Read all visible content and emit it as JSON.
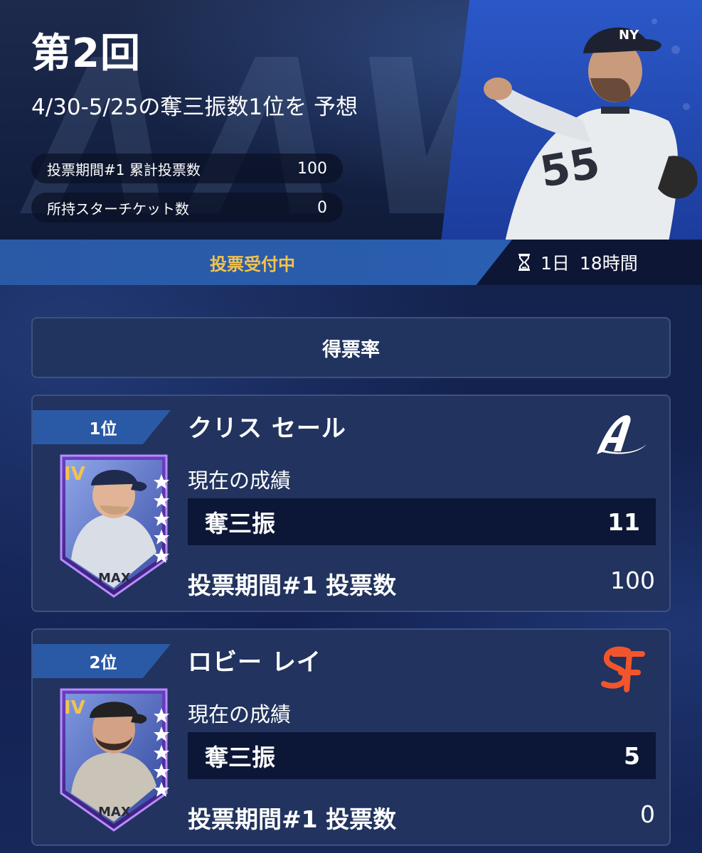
{
  "hero": {
    "round_title": "第2回",
    "subtitle": "4/30-5/25の奪三振数1位を 予想",
    "stats": [
      {
        "label": "投票期間#1 累計投票数",
        "value": "100"
      },
      {
        "label": "所持スターチケット数",
        "value": "0"
      }
    ]
  },
  "status": {
    "label": "投票受付中",
    "countdown_days": "1日",
    "countdown_hours": "18時間",
    "icon": "hourglass-icon"
  },
  "vote_rate_button": {
    "label": "得票率"
  },
  "players": [
    {
      "rank": "1位",
      "name": "クリス セール",
      "team_icon": "braves-logo-icon",
      "card_grade": "IV",
      "card_level": "MAX",
      "current_stats_label": "現在の成績",
      "stat_label": "奪三振",
      "stat_value": "11",
      "votes_label": "投票期間#1 投票数",
      "votes_value": "100"
    },
    {
      "rank": "2位",
      "name": "ロビー レイ",
      "team_icon": "giants-logo-icon",
      "card_grade": "IV",
      "card_level": "MAX",
      "current_stats_label": "現在の成績",
      "stat_label": "奪三振",
      "stat_value": "5",
      "votes_label": "投票期間#1 投票数",
      "votes_value": "0"
    }
  ],
  "colors": {
    "accent_blue": "#2a5aa6",
    "status_gold": "#f3c34c",
    "card_bg": "#21335e",
    "giants_orange": "#f2552c"
  }
}
